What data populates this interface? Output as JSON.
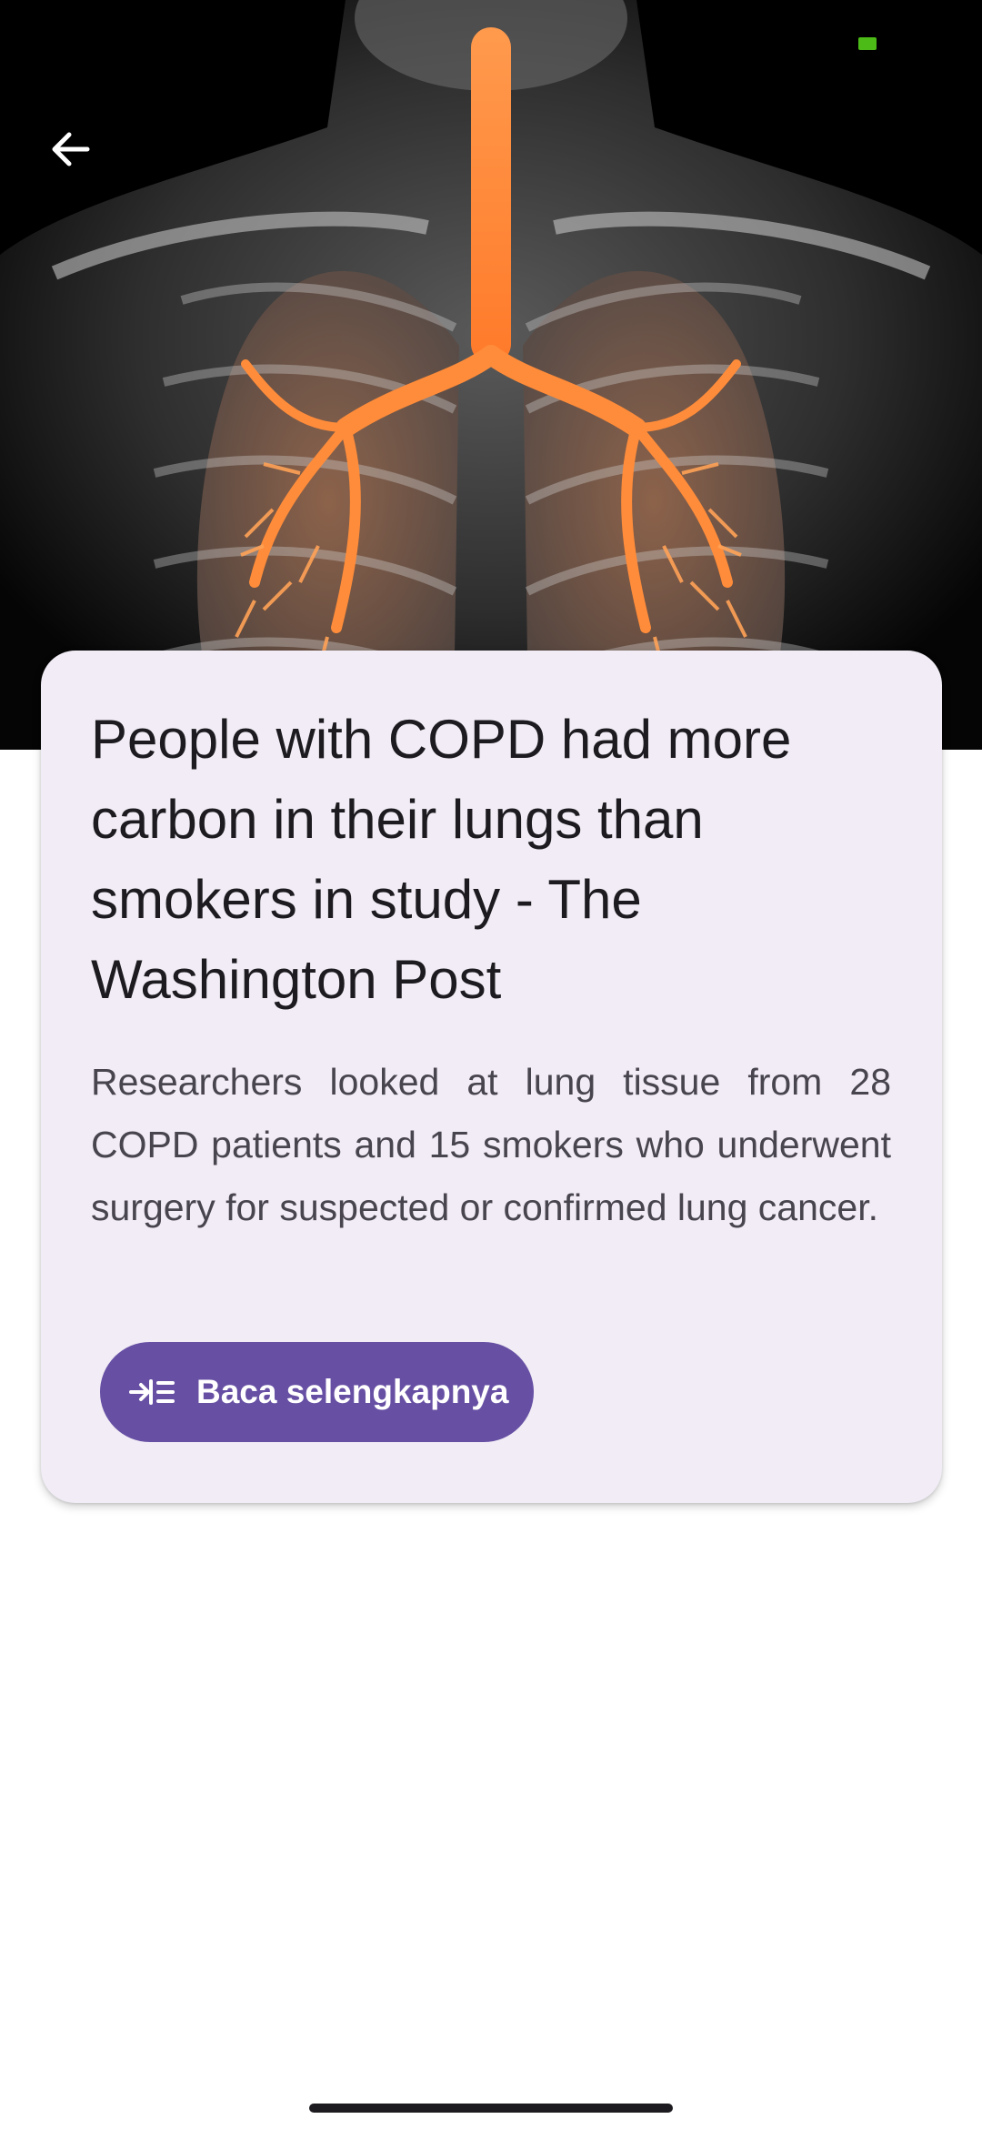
{
  "hero": {
    "image_alt": "Illustration of human lungs and bronchial tree"
  },
  "navigation": {
    "back_icon": "arrow-left-icon"
  },
  "article": {
    "title": "People with COPD had more carbon in their lungs than smokers in study - The Washington Post",
    "summary": "Researchers looked at lung tissue from 28 COPD patients and 15 smokers who underwent surgery for suspected or confirmed lung cancer.",
    "read_more_label": "Baca selengkapnya",
    "read_more_icon": "read-more-icon"
  },
  "colors": {
    "accent": "#6750a4",
    "card_background": "#f1ecf5",
    "title_text": "#1d1b20",
    "body_text": "#49454f",
    "battery": "#4cbb17"
  }
}
